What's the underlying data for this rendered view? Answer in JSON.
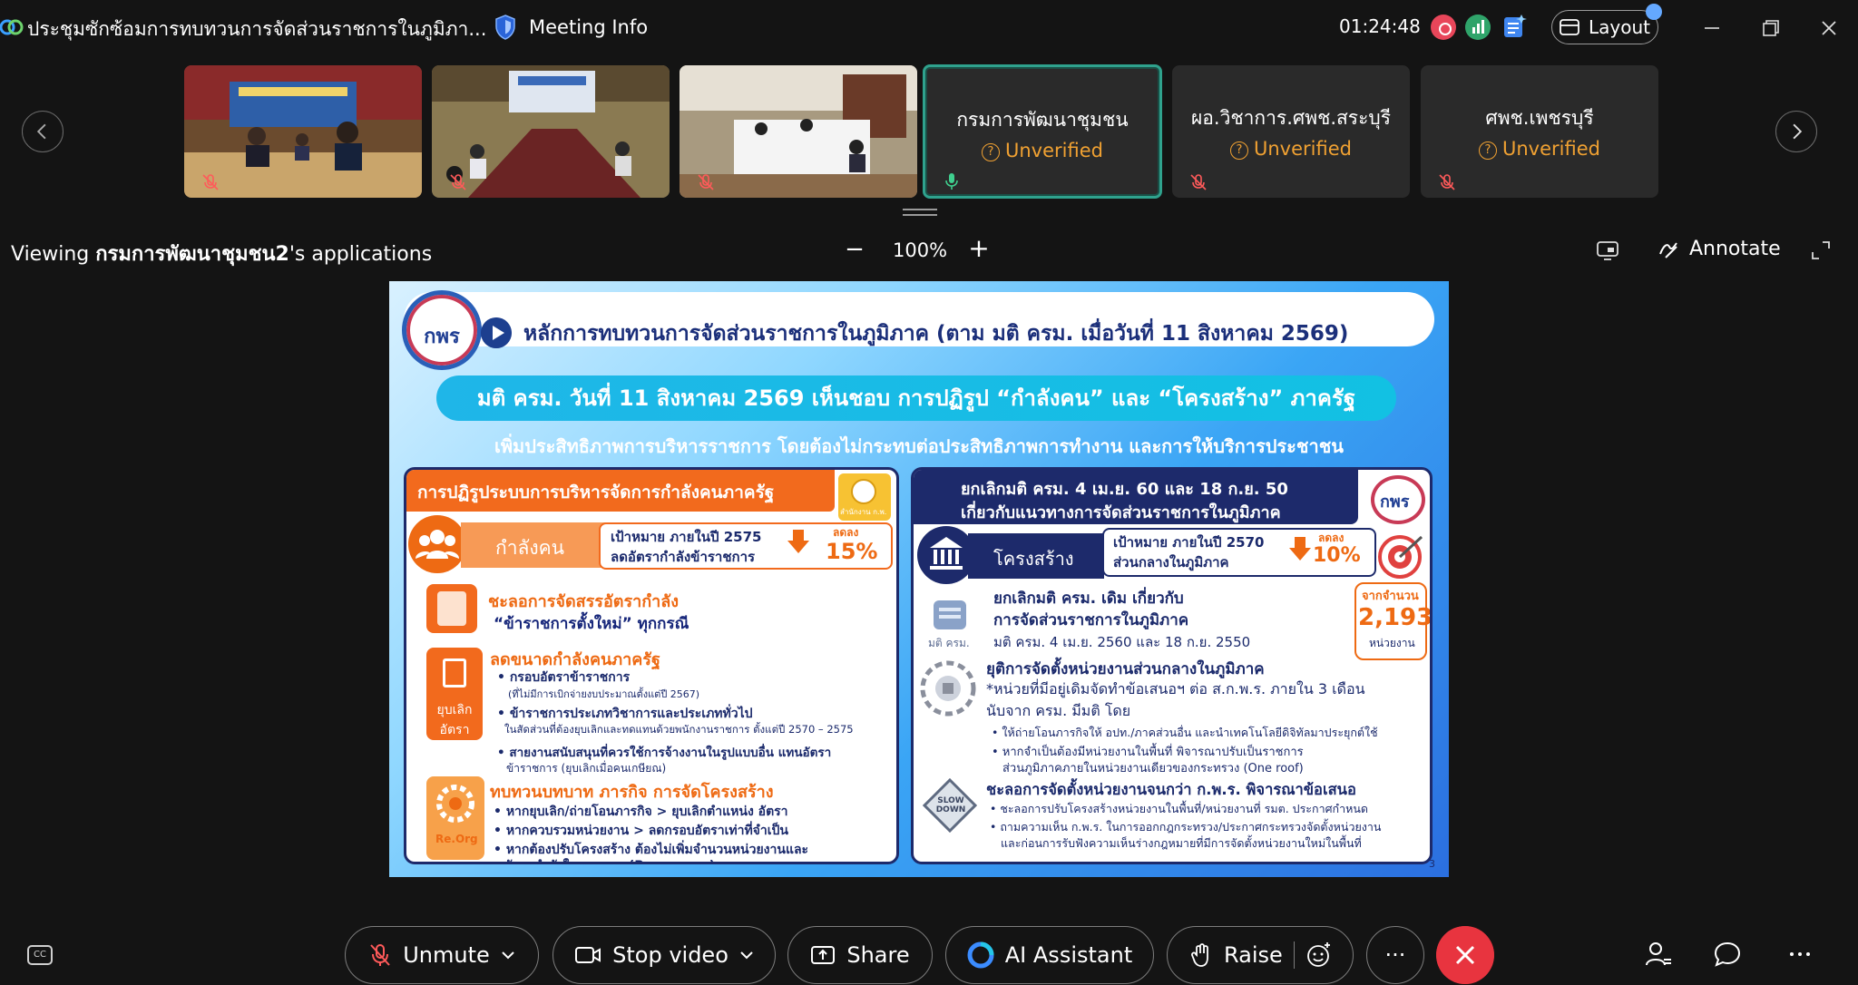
{
  "window": {
    "title": "ประชุมซักซ้อมการทบทวนการจัดส่วนราชการในภูมิภา...",
    "meeting_info_label": "Meeting Info",
    "clock": "01:24:48",
    "layout_label": "Layout"
  },
  "participants": [
    {
      "kind": "video",
      "muted": true
    },
    {
      "kind": "video",
      "muted": true
    },
    {
      "kind": "video",
      "muted": true
    },
    {
      "kind": "name",
      "name": "กรมการพัฒนาชุมชน",
      "status": "Unverified",
      "muted": false,
      "active": true
    },
    {
      "kind": "name",
      "name": "ผอ.วิชาการ.ศพช.สระบุรี",
      "status": "Unverified",
      "muted": true,
      "active": false
    },
    {
      "kind": "name",
      "name": "ศพช.เพชรบุรี",
      "status": "Unverified",
      "muted": true,
      "active": false
    }
  ],
  "share": {
    "viewing_prefix": "Viewing ",
    "owner": "กรมการพัฒนาชุมชน2",
    "viewing_suffix": "'s applications",
    "zoom": "100%",
    "annotate_label": "Annotate"
  },
  "slide": {
    "logo_text": "กพร",
    "title": "หลักการทบทวนการจัดส่วนราชการในภูมิภาค (ตาม มติ ครม. เมื่อวันที่ 11 สิงหาคม 2569)",
    "subtitle": "มติ ครม. วันที่ 11 สิงหาคม 2569 เห็นชอบ การปฏิรูป “กำลังคน”  และ “โครงสร้าง” ภาครัฐ",
    "tagline": "เพิ่มประสิทธิภาพการบริหารราชการ โดยต้องไม่กระทบต่อประสิทธิภาพการทำงาน และการให้บริการประชาชน",
    "left": {
      "heading": "การปฏิรูประบบการบริหารจัดการกำลังคนภาครัฐ",
      "badge": "สำนักงาน ก.พ.",
      "tag": "กำลังคน",
      "target_line1": "เป้าหมาย ภายในปี 2575",
      "target_line2": "ลดอัตรากำลังข้าราชการ",
      "reduce_label": "ลดลง",
      "reduce_pct": "15%",
      "item1_line1": "ชะลอการจัดสรรอัตรากำลัง",
      "item1_line2": "“ข้าราชการตั้งใหม่” ทุกกรณี",
      "item2_head": "ลดขนาดกำลังคนภาครัฐ",
      "item2_icon_label": "ยุบเลิก อัตรา",
      "item2_b1": "• กรอบอัตราข้าราชการ",
      "item2_b1_note": "(ที่ไม่มีการเบิกจ่ายงบประมาณตั้งแต่ปี 2567)",
      "item2_b2": "• ข้าราชการประเภทวิชาการและประเภททั่วไป",
      "item2_b2_note": "ในสัดส่วนที่ต้องยุบเลิกและทดแทนด้วยพนักงานราชการ ตั้งแต่ปี 2570 – 2575",
      "item2_b3": "• สายงานสนับสนุนที่ควรใช้การจ้างงานในรูปแบบอื่น แทนอัตรา",
      "item2_b3_l2": "ข้าราชการ (ยุบเลิกเมื่อคนเกษียณ)",
      "item3_head": "ทบทวนบทบาท ภารกิจ การจัดโครงสร้าง",
      "item3_icon_label": "Re.Org",
      "item3_b1": "• หากยุบเลิก/ถ่ายโอนภารกิจ > ยุบเลิกตำแหน่ง อัตรา",
      "item3_b2": "• หากควบรวมหน่วยงาน > ลดกรอบอัตราเท่าที่จำเป็น",
      "item3_b3": "• หากต้องปรับโครงสร้าง ต้องไม่เพิ่มจำนวนหน่วยงานและ",
      "item3_b3_l2": "อัตรากำลังในภาพรวม (Rearrange)"
    },
    "right": {
      "heading_line1": "ยกเลิกมติ ครม. 4 เม.ย. 60 และ 18 ก.ย. 50",
      "heading_line2": "เกี่ยวกับแนวทางการจัดส่วนราชการในภูมิภาค",
      "logo_text": "กพร",
      "tag": "โครงสร้าง",
      "target_line1": "เป้าหมาย ภายในปี 2570",
      "target_line2": "ส่วนกลางในภูมิภาค",
      "reduce_label": "ลดลง",
      "reduce_pct": "10%",
      "count_label": "จากจำนวน",
      "count_value": "2,193",
      "count_unit": "หน่วยงาน",
      "r1_line1": "ยกเลิกมติ ครม. เดิม เกี่ยวกับ",
      "r1_line2": "การจัดส่วนราชการในภูมิภาค",
      "r1_line3": "มติ ครม. 4 เม.ย. 2560 และ 18 ก.ย. 2550",
      "r1_icon_label": "มติ ครม.",
      "r2_head": "ยุติการจัดตั้งหน่วยงานส่วนกลางในภูมิภาค",
      "r2_l1": "*หน่วยที่มีอยู่เดิมจัดทำข้อเสนอฯ ต่อ ส.ก.พ.ร. ภายใน 3 เดือน",
      "r2_l2": "นับจาก ครม. มีมติ โดย",
      "r2_b1": "• ให้ถ่ายโอนภารกิจให้ อปท./ภาคส่วนอื่น และนำเทคโนโลยีดิจิทัลมาประยุกต์ใช้",
      "r2_b2": "• หากจำเป็นต้องมีหน่วยงานในพื้นที่ พิจารณาปรับเป็นราชการ",
      "r2_b2_l2": "ส่วนภูมิภาคภายในหน่วยงานเดียวของกระทรวง (One roof)",
      "r3_icon_label": "SLOW DOWN",
      "r3_head": "ชะลอการจัดตั้งหน่วยงานจนกว่า ก.พ.ร. พิจารณาข้อเสนอ",
      "r3_b1": "• ชะลอการปรับโครงสร้างหน่วยงานในพื้นที่/หน่วยงานที่ รมต. ประกาศกำหนด",
      "r3_b2": "• ถามความเห็น ก.พ.ร. ในการออกกฎกระทรวง/ประกาศกระทรวงจัดตั้งหน่วยงาน",
      "r3_b2_l2": "และก่อนการรับฟังความเห็นร่างกฎหมายที่มีการจัดตั้งหน่วยงานใหม่ในพื้นที่"
    },
    "page_number": "3"
  },
  "toolbar": {
    "unmute_label": "Unmute",
    "stop_video_label": "Stop video",
    "share_label": "Share",
    "ai_label": "AI Assistant",
    "raise_label": "Raise",
    "more_label": "···",
    "cc_label": "CC"
  },
  "colors": {
    "background": "#141414",
    "unverified": "#f0a132",
    "active_tile_border": "#2fa28d",
    "end_call": "#e8343f",
    "record": "#e8465a"
  }
}
